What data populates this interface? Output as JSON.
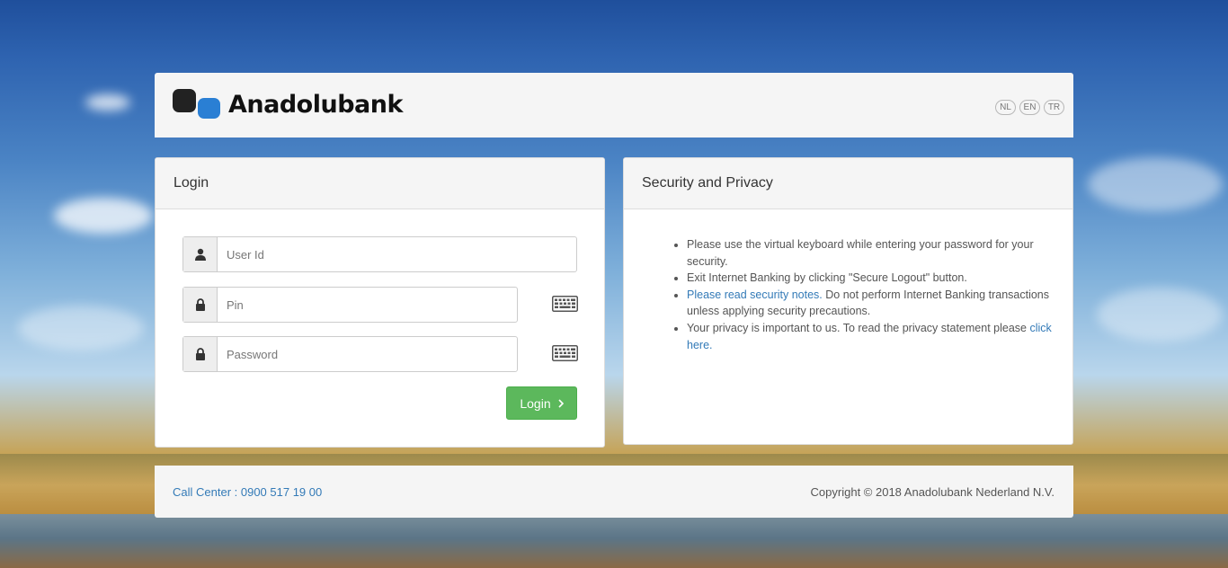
{
  "brand": {
    "name": "Anadolubank",
    "dark_color": "#222222",
    "blue_color": "#2a7fd4"
  },
  "languages": [
    "NL",
    "EN",
    "TR"
  ],
  "login": {
    "title": "Login",
    "user_placeholder": "User Id",
    "pin_placeholder": "Pin",
    "password_placeholder": "Password",
    "button_label": "Login",
    "button_color": "#5cb85c",
    "icons": {
      "user": "user-icon",
      "pin": "lock-icon",
      "password": "lock-icon",
      "keyboard": "keyboard-icon",
      "arrow": "chevron-right-icon"
    }
  },
  "security": {
    "title": "Security and Privacy",
    "items": [
      {
        "text": "Please use the virtual keyboard while entering your password for your security."
      },
      {
        "text": "Exit Internet Banking by clicking \"Secure Logout\" button."
      },
      {
        "link": "Please read security notes.",
        "text": " Do not perform Internet Banking transactions unless applying security precautions."
      },
      {
        "text": "Your privacy is important to us. To read the privacy statement please ",
        "link": "click here."
      }
    ],
    "link_color": "#337ab7"
  },
  "footer": {
    "call_center": "Call Center : 0900 517 19 00",
    "copyright": "Copyright © 2018 Anadolubank Nederland N.V."
  }
}
